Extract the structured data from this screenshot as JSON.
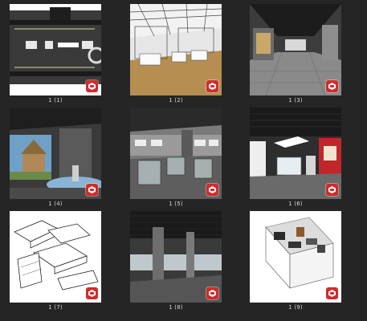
{
  "thumbnails": [
    {
      "caption": "1 (1)",
      "scene": "floorplan-black-white",
      "icon": "sketchup-icon"
    },
    {
      "caption": "1 (2)",
      "scene": "wireframe-showroom-wood-floor",
      "icon": "sketchup-icon"
    },
    {
      "caption": "1 (3)",
      "scene": "dark-corridor-exhibition",
      "icon": "sketchup-icon"
    },
    {
      "caption": "1 (4)",
      "scene": "hut-diorama-exhibit",
      "icon": "sketchup-icon"
    },
    {
      "caption": "1 (5)",
      "scene": "grey-hall-showcases",
      "icon": "sketchup-icon"
    },
    {
      "caption": "1 (6)",
      "scene": "white-red-gallery",
      "icon": "sketchup-icon"
    },
    {
      "caption": "1 (7)",
      "scene": "white-massing-model",
      "icon": "sketchup-icon"
    },
    {
      "caption": "1 (8)",
      "scene": "dark-columns-hall",
      "icon": "sketchup-icon"
    },
    {
      "caption": "1 (9)",
      "scene": "cutaway-room-model",
      "icon": "sketchup-icon"
    }
  ],
  "colors": {
    "background": "#252525",
    "caption_text": "#d8d8d8",
    "badge_red": "#d42a2a"
  }
}
